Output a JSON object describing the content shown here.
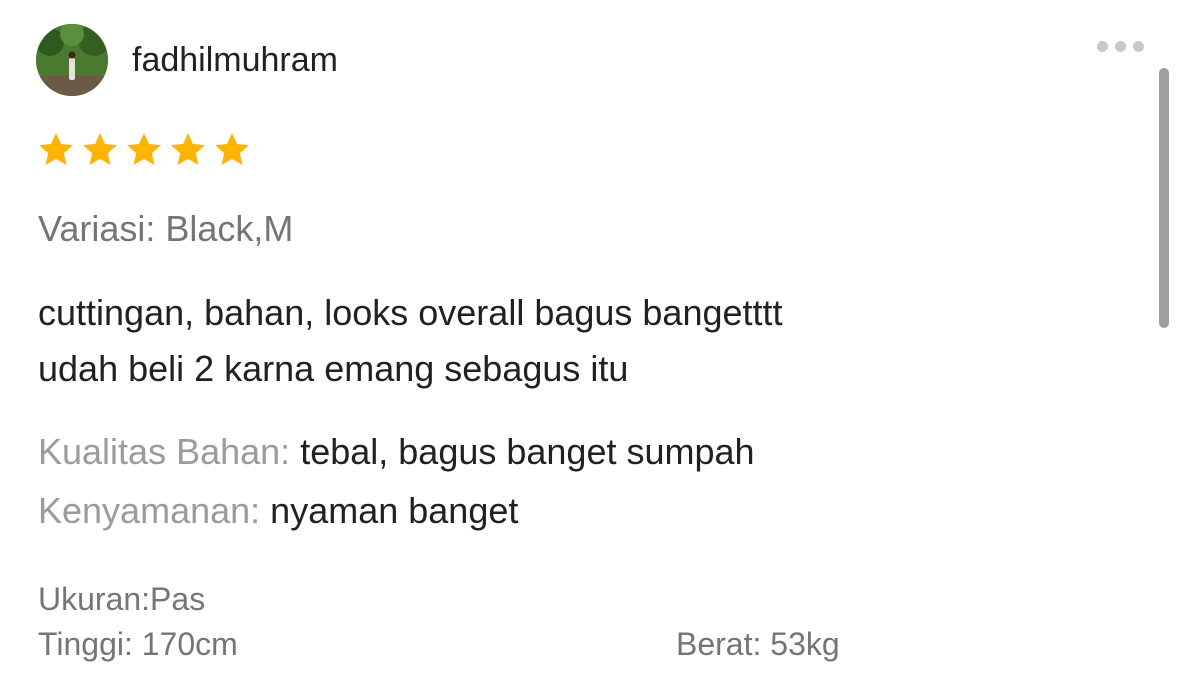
{
  "user": {
    "avatar_icon": "user-avatar-photo",
    "name": "fadhilmuhram"
  },
  "menu": {
    "icon": "more-horizontal-icon"
  },
  "rating": {
    "value": 5,
    "max": 5,
    "star_color": "#FFB400"
  },
  "variant": {
    "text": "Variasi: Black,M"
  },
  "review": {
    "lines": [
      "cuttingan, bahan, looks overall bagus bangetttt",
      "udah beli 2 karna emang sebagus itu"
    ]
  },
  "attributes": [
    {
      "label": "Kualitas Bahan:",
      "value": "tebal, bagus banget sumpah"
    },
    {
      "label": "Kenyamanan:",
      "value": "nyaman banget"
    }
  ],
  "fit": {
    "size": "Ukuran:Pas",
    "height": "Tinggi: 170cm",
    "weight": "Berat: 53kg"
  },
  "colors": {
    "text_primary": "#212121",
    "text_secondary": "#757575",
    "label_muted": "#9B9B9B"
  }
}
